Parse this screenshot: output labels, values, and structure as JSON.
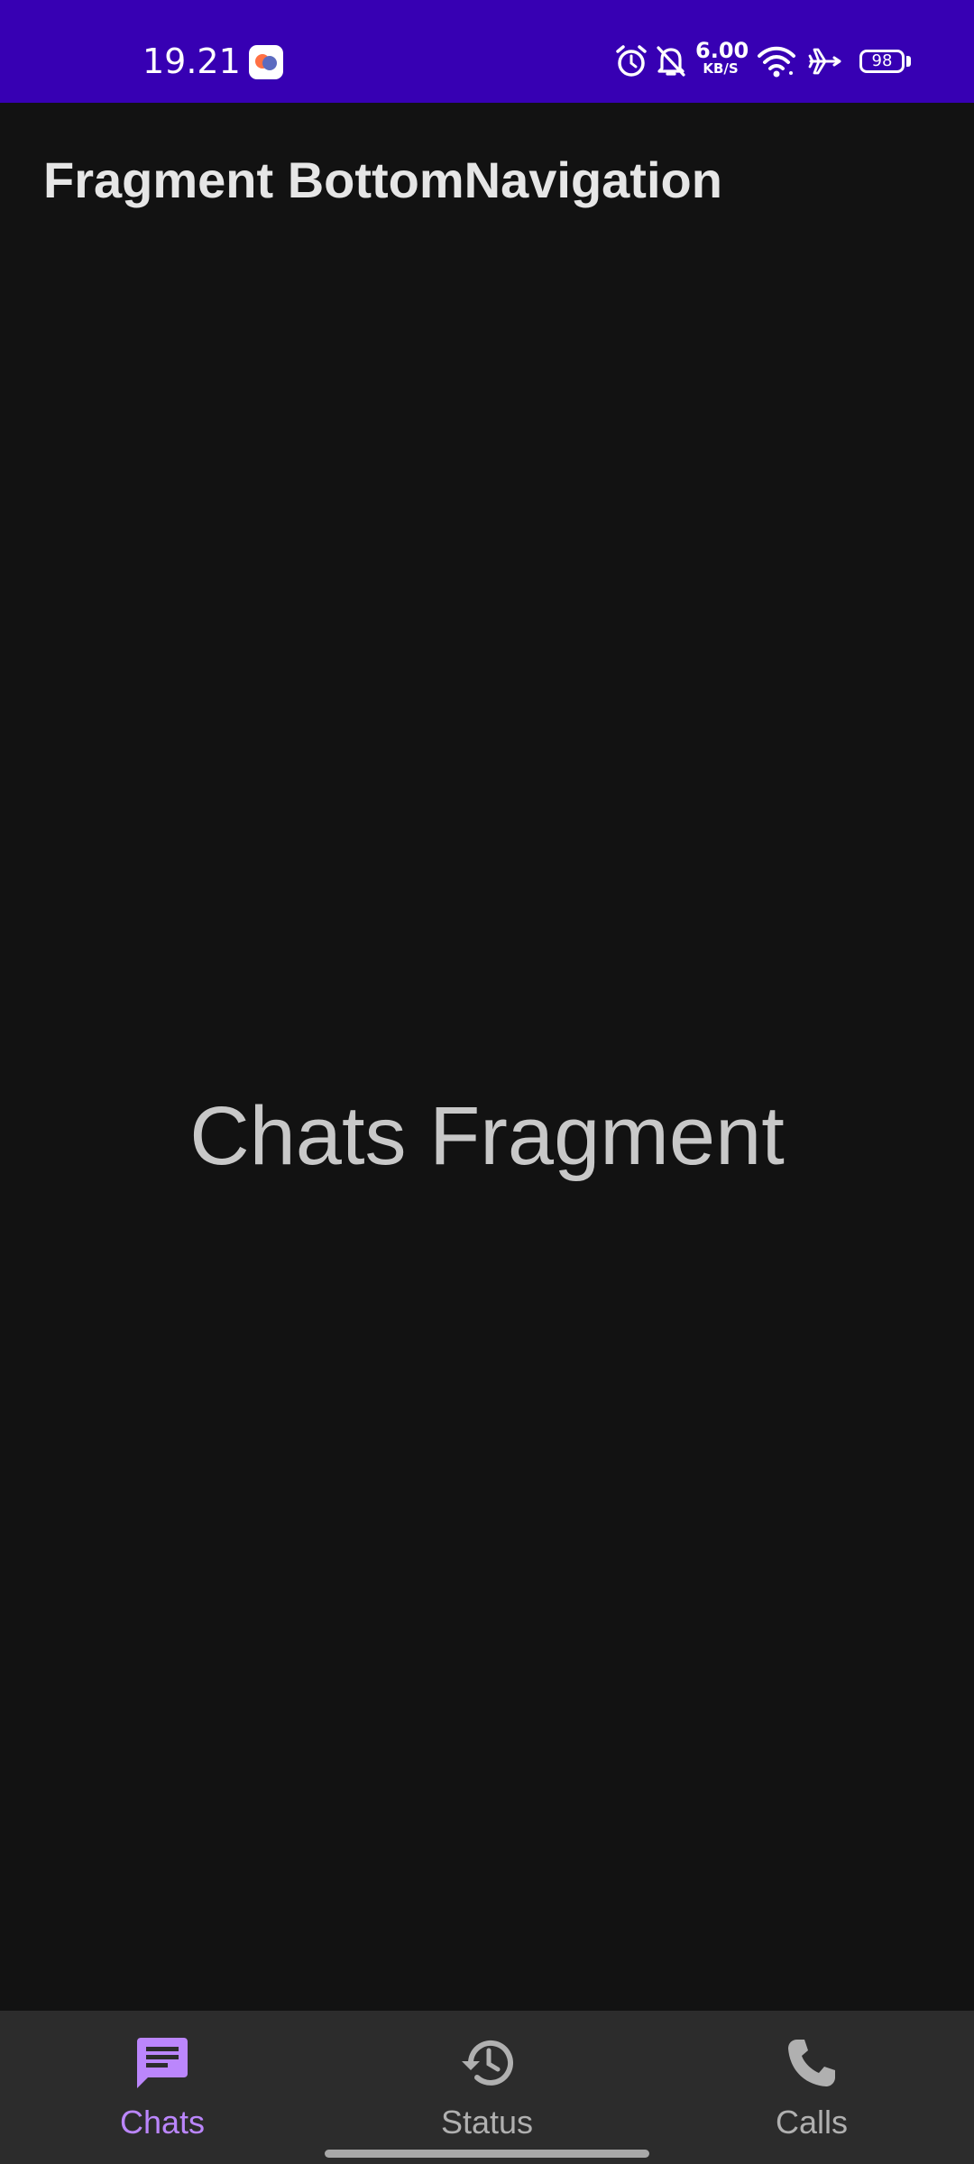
{
  "status_bar": {
    "time": "19.21",
    "net_speed_value": "6.00",
    "net_speed_unit": "KB/S",
    "battery_level": "98",
    "background_color": "#3700b3",
    "icons": [
      "app-notification-icon",
      "alarm-icon",
      "bell-off-icon",
      "wifi-icon",
      "airplane-icon",
      "battery-icon"
    ]
  },
  "app_bar": {
    "title": "Fragment BottomNavigation"
  },
  "content": {
    "text": "Chats Fragment"
  },
  "bottom_nav": {
    "accent_color": "#bb86fc",
    "items": [
      {
        "label": "Chats",
        "icon": "chat-icon",
        "active": true
      },
      {
        "label": "Status",
        "icon": "history-icon",
        "active": false
      },
      {
        "label": "Calls",
        "icon": "phone-icon",
        "active": false
      }
    ]
  }
}
